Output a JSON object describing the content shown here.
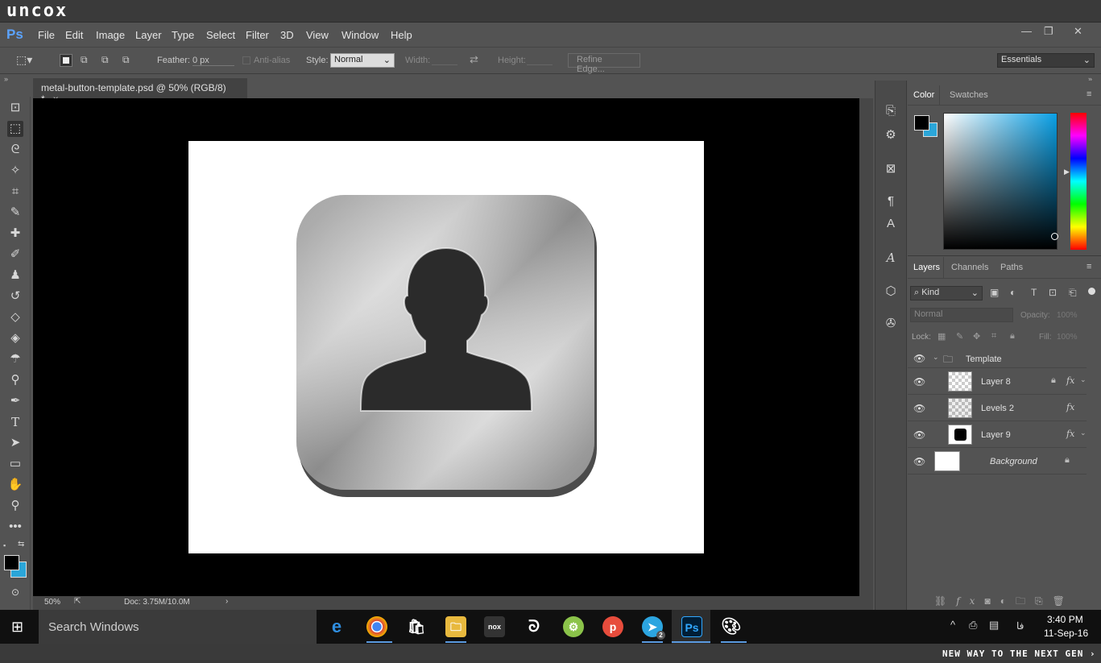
{
  "banner": {
    "brand": "uncox",
    "tagline": "NEW WAY TO THE NEXT GEN ›"
  },
  "app": {
    "logo": "Ps",
    "menu": [
      "File",
      "Edit",
      "Image",
      "Layer",
      "Type",
      "Select",
      "Filter",
      "3D",
      "View",
      "Window",
      "Help"
    ],
    "window_controls": [
      "—",
      "❐",
      "✕"
    ]
  },
  "options": {
    "feather_label": "Feather:",
    "feather_value": "0 px",
    "antialias_label": "Anti-alias",
    "style_label": "Style:",
    "style_value": "Normal",
    "width_label": "Width:",
    "height_label": "Height:",
    "refine_edge": "Refine Edge...",
    "workspace": "Essentials"
  },
  "document": {
    "tab_title": "metal-button-template.psd @ 50% (RGB/8) *",
    "close": "×",
    "zoom": "50%",
    "doc_size": "Doc: 3.75M/10.0M"
  },
  "tools": {
    "icons": [
      "artboard-icon",
      "marquee-icon",
      "lasso-icon",
      "magic-wand-icon",
      "crop-icon",
      "eyedropper-icon",
      "healing-icon",
      "brush-icon",
      "stamp-icon",
      "history-brush-icon",
      "eraser-icon",
      "bucket-icon",
      "blur-icon",
      "dodge-icon",
      "pen-icon",
      "type-icon",
      "path-select-icon",
      "rectangle-icon",
      "hand-icon",
      "zoom-icon",
      "more-icon"
    ],
    "fg_color": "#000000",
    "bg_color": "#2ba6d9"
  },
  "color_panel": {
    "tabs": [
      "Color",
      "Swatches"
    ],
    "fg": "#000000",
    "bg": "#2ba6d9",
    "hue_color": "#0aa0e6"
  },
  "layers_panel": {
    "tabs": [
      "Layers",
      "Channels",
      "Paths"
    ],
    "filter_kind": "Kind",
    "blend_mode": "Normal",
    "opacity_label": "Opacity:",
    "opacity_value": "100%",
    "lock_label": "Lock:",
    "fill_label": "Fill:",
    "fill_value": "100%",
    "layers": [
      {
        "name": "Template",
        "type": "group"
      },
      {
        "name": "Layer 8",
        "fx": "fx",
        "locked": true
      },
      {
        "name": "Levels 2",
        "fx": "fx"
      },
      {
        "name": "Layer 9",
        "fx": "fx"
      },
      {
        "name": "Background",
        "locked": true
      }
    ]
  },
  "taskbar": {
    "search_placeholder": "Search Windows",
    "apps": [
      "Edge",
      "Chrome",
      "Store",
      "File Explorer",
      "Nox",
      "Dragon",
      "Android",
      "Pocket",
      "Telegram",
      "Photoshop",
      "Paint"
    ],
    "telegram_badge": "2",
    "time": "3:40 PM",
    "date": "11-Sep-16",
    "lang": "فا"
  }
}
